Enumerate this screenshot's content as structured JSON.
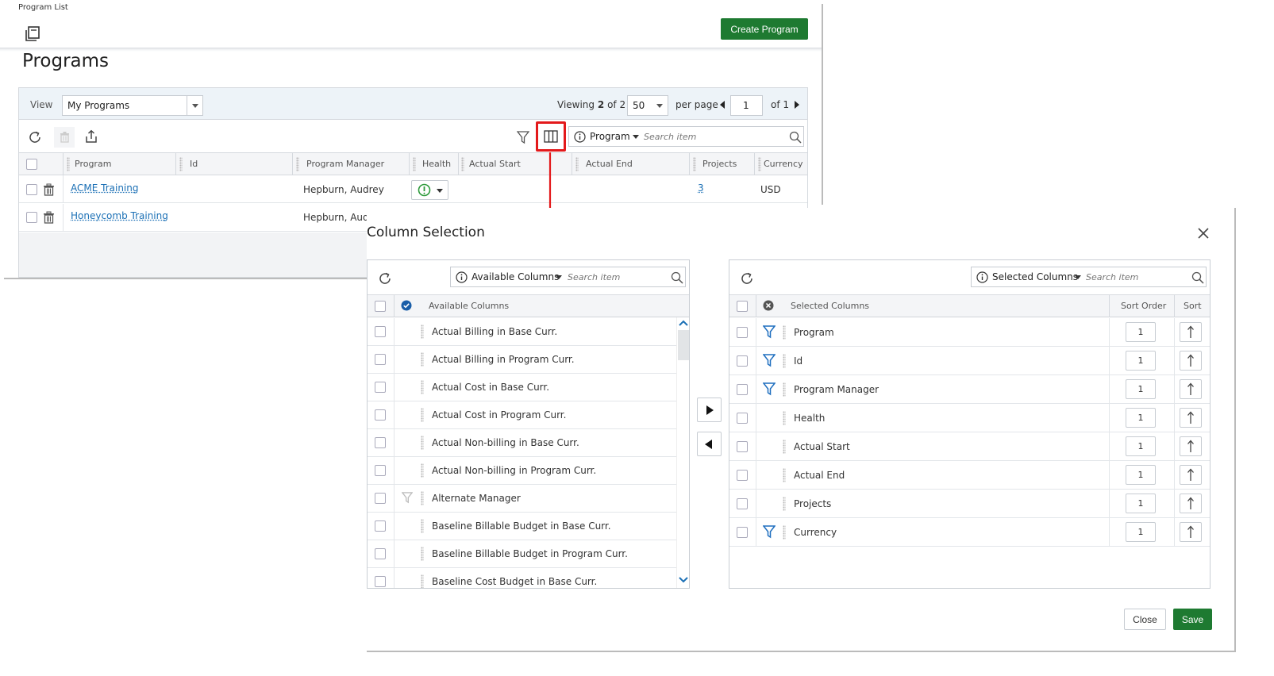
{
  "app": {
    "breadcrumb": "Program List",
    "create_button": "Create Program",
    "page_title": "Programs"
  },
  "grid": {
    "view_label": "View",
    "view_value": "My Programs",
    "viewing_prefix": "Viewing",
    "viewing_count": "2",
    "viewing_of": "of 2",
    "per_page_value": "50",
    "per_page_label": "per page",
    "page_number": "1",
    "page_of": "of 1",
    "search_scope": "Program",
    "search_placeholder": "Search item",
    "columns": [
      "Program",
      "Id",
      "Program Manager",
      "Health",
      "Actual Start",
      "Actual End",
      "Projects",
      "Currency"
    ],
    "rows": [
      {
        "program": "ACME Training",
        "manager": "Hepburn, Audrey",
        "projects": "3",
        "currency": "USD",
        "health_color": "#2e9a3c"
      },
      {
        "program": "Honeycomb Training",
        "manager": "Hepburn, Aud"
      }
    ]
  },
  "dialog": {
    "title": "Column Selection",
    "available": {
      "search_scope": "Available Columns",
      "search_placeholder": "Search item",
      "header": "Available Columns",
      "items": [
        {
          "label": "Actual Billing in Base Curr.",
          "filter": false
        },
        {
          "label": "Actual Billing in Program Curr.",
          "filter": false
        },
        {
          "label": "Actual Cost in Base Curr.",
          "filter": false
        },
        {
          "label": "Actual Cost in Program Curr.",
          "filter": false
        },
        {
          "label": "Actual Non-billing in Base Curr.",
          "filter": false
        },
        {
          "label": "Actual Non-billing in Program Curr.",
          "filter": false
        },
        {
          "label": "Alternate Manager",
          "filter": true
        },
        {
          "label": "Baseline Billable Budget in Base Curr.",
          "filter": false
        },
        {
          "label": "Baseline Billable Budget in Program Curr.",
          "filter": false
        },
        {
          "label": "Baseline Cost Budget in Base Curr.",
          "filter": false
        }
      ]
    },
    "selected": {
      "search_scope": "Selected Columns",
      "search_placeholder": "Search item",
      "header": "Selected Columns",
      "sort_order_header": "Sort Order",
      "sort_header": "Sort",
      "items": [
        {
          "label": "Program",
          "filter": true,
          "order": "1"
        },
        {
          "label": "Id",
          "filter": true,
          "order": "1"
        },
        {
          "label": "Program Manager",
          "filter": true,
          "order": "1"
        },
        {
          "label": "Health",
          "filter": false,
          "order": "1"
        },
        {
          "label": "Actual Start",
          "filter": false,
          "order": "1"
        },
        {
          "label": "Actual End",
          "filter": false,
          "order": "1"
        },
        {
          "label": "Projects",
          "filter": false,
          "order": "1"
        },
        {
          "label": "Currency",
          "filter": true,
          "order": "1"
        }
      ]
    },
    "close_button": "Close",
    "save_button": "Save"
  },
  "colors": {
    "accent_green": "#1e7a31",
    "link_blue": "#1a6fb5",
    "highlight_red": "#e3191b",
    "filter_blue": "#1f6fbf"
  }
}
